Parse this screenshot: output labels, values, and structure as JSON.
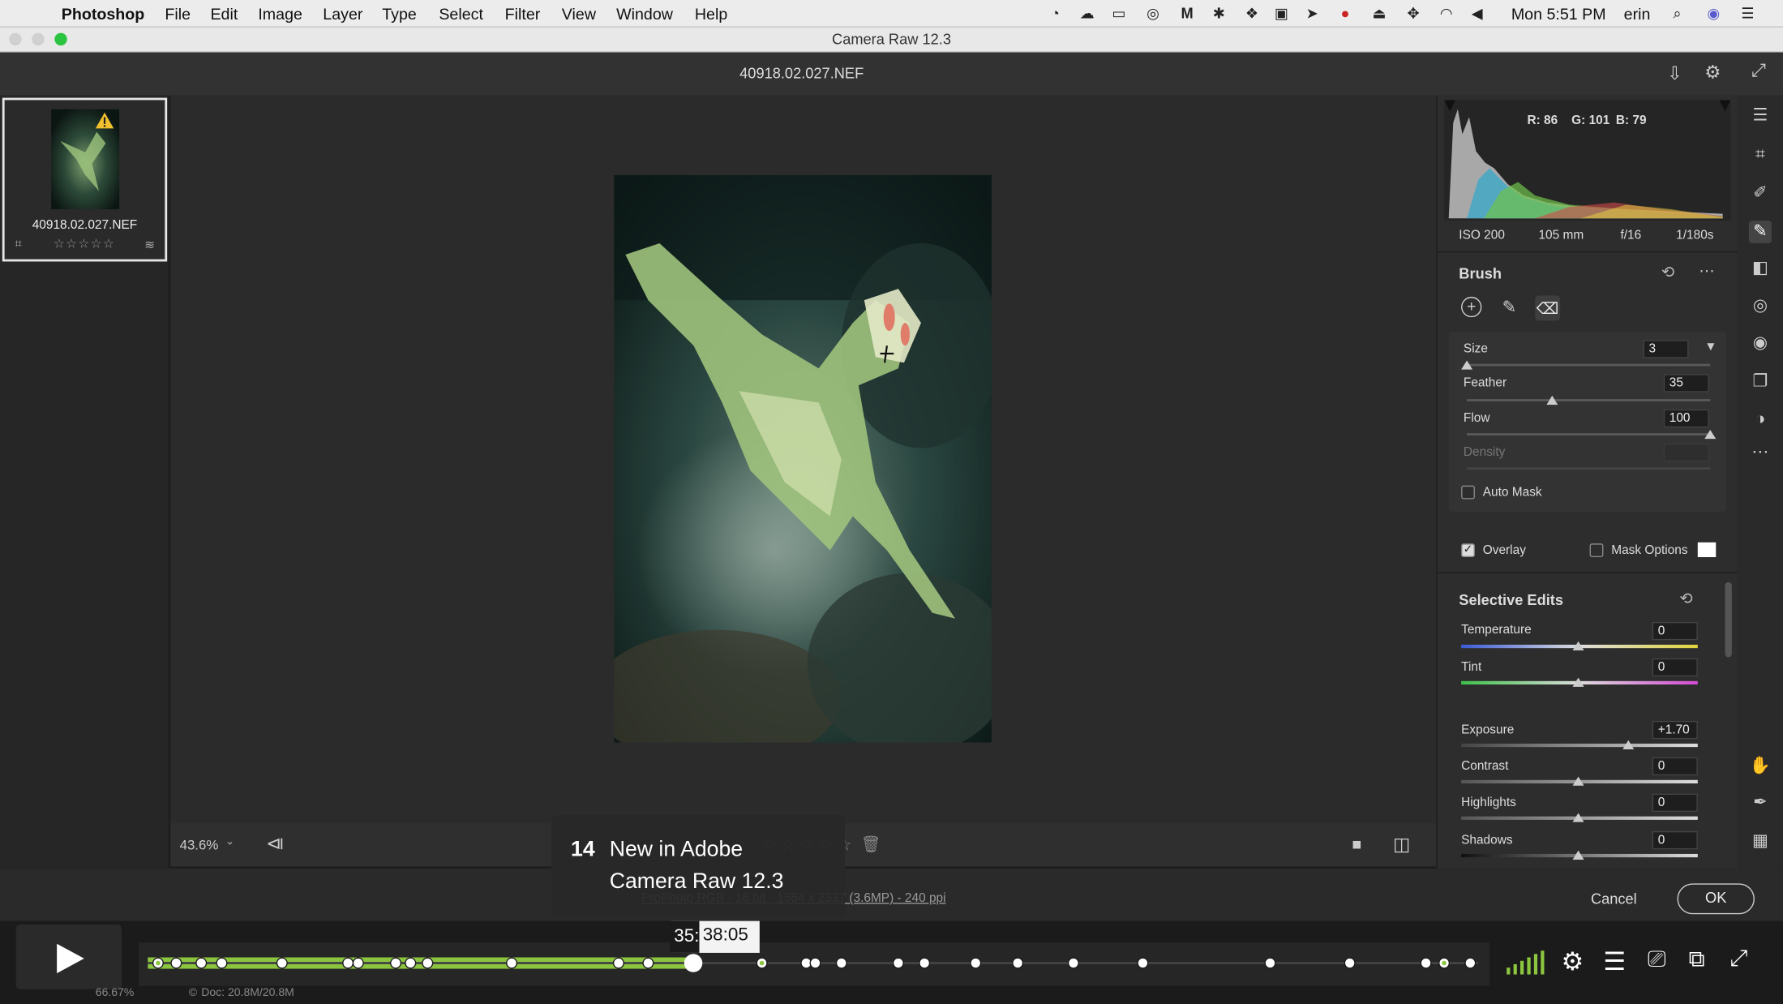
{
  "menubar": {
    "app_name": "Photoshop",
    "items": [
      "File",
      "Edit",
      "Image",
      "Layer",
      "Type",
      "Select",
      "Filter",
      "View",
      "Window",
      "Help"
    ],
    "clock": "Mon 5:51 PM",
    "user": "erin"
  },
  "window": {
    "title": "Camera Raw 12.3"
  },
  "header": {
    "filename": "40918.02.027.NEF"
  },
  "filmstrip": {
    "thumb_label": "40918.02.027.NEF",
    "stars": "☆☆☆☆☆"
  },
  "canvas": {
    "zoom": "43.6%"
  },
  "histogram": {
    "r": "R: 86",
    "g": "G: 101",
    "b": "B: 79"
  },
  "exif": {
    "iso": "ISO 200",
    "focal": "105 mm",
    "aperture": "f/16",
    "shutter": "1/180s"
  },
  "brush": {
    "title": "Brush",
    "size_label": "Size",
    "size_value": "3",
    "size_level": 0.0,
    "feather_label": "Feather",
    "feather_value": "35",
    "feather_level": 0.35,
    "flow_label": "Flow",
    "flow_value": "100",
    "flow_level": 1.0,
    "density_label": "Density",
    "auto_mask_label": "Auto Mask",
    "overlay_label": "Overlay",
    "mask_options_label": "Mask Options"
  },
  "selective": {
    "title": "Selective Edits",
    "temperature_label": "Temperature",
    "temperature_value": "0",
    "tint_label": "Tint",
    "tint_value": "0",
    "exposure_label": "Exposure",
    "exposure_value": "+1.70",
    "contrast_label": "Contrast",
    "contrast_value": "0",
    "highlights_label": "Highlights",
    "highlights_value": "0",
    "shadows_label": "Shadows",
    "shadows_value": "0"
  },
  "footer": {
    "info": "ProPhoto RGB - 16 bit - 1554 x 2337 (3.6MP) - 240 ppi",
    "cancel": "Cancel",
    "ok": "OK",
    "ps_zoom": "66.67%",
    "doc": "Doc: 20.8M/20.8M"
  },
  "video": {
    "chapter_number": "14",
    "chapter_title_1": "New in Adobe",
    "chapter_title_2": "Camera Raw 12.3",
    "time_prefix": "35:",
    "time": "38:05",
    "progress": 0.41
  },
  "colors": {
    "accent": "#8cc63f",
    "panel": "#2d2d2d"
  }
}
